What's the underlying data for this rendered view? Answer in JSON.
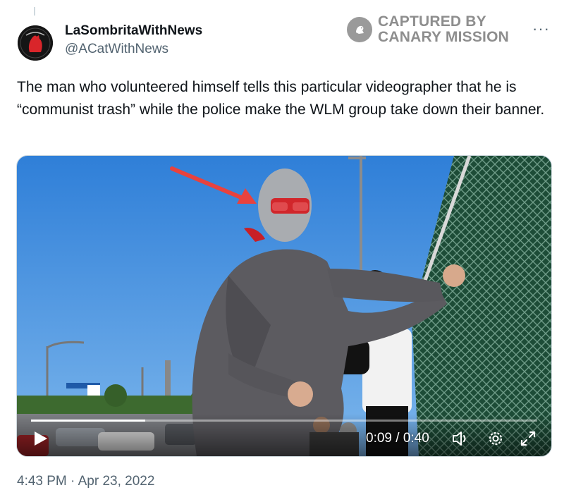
{
  "tweet": {
    "display_name": "LaSombritaWithNews",
    "handle": "@ACatWithNews",
    "text": "The man who volunteered himself tells this particular videographer that he is “communist trash” while the police make the WLM group take down their banner.",
    "timestamp": "4:43 PM · Apr 23, 2022",
    "more_label": "···"
  },
  "watermark": {
    "line1": "CAPTURED BY",
    "line2": "CANARY MISSION"
  },
  "video": {
    "time_display": "0:09 / 0:40",
    "progress": 0.225
  },
  "icons": {
    "avatar": "avatar",
    "watermark": "canary-logo-icon",
    "more": "more-icon",
    "play": "play-icon",
    "volume": "volume-icon",
    "settings": "settings-icon",
    "fullscreen": "fullscreen-icon"
  },
  "colors": {
    "text": "#0f1419",
    "secondary": "#536471",
    "watermark": "#8e8e8e",
    "sky": "#3d8ce0",
    "fence": "#1f4a38"
  }
}
